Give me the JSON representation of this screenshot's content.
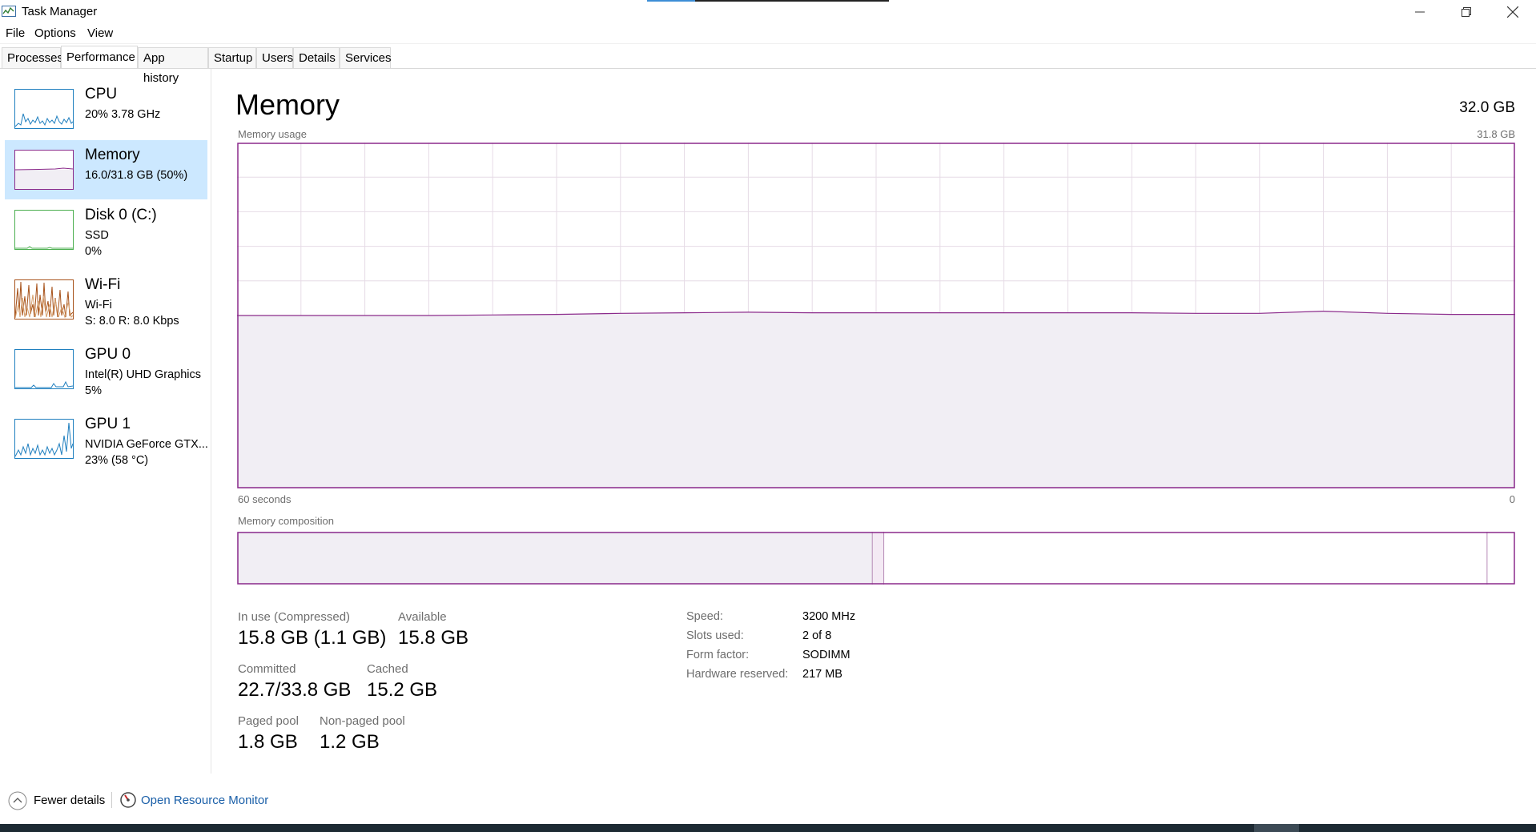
{
  "window": {
    "title": "Task Manager"
  },
  "colors": {
    "memory": "#8b2a8b",
    "cpu": "#1f7fbf",
    "disk": "#4caf50",
    "wifi": "#a7521a",
    "tab_border": "#d9d9d9",
    "selected_bg": "#cce8ff",
    "link": "#1a5fa8"
  },
  "menu": {
    "file": "File",
    "options": "Options",
    "view": "View"
  },
  "tabs": [
    {
      "label": "Processes"
    },
    {
      "label": "Performance"
    },
    {
      "label": "App history"
    },
    {
      "label": "Startup"
    },
    {
      "label": "Users"
    },
    {
      "label": "Details"
    },
    {
      "label": "Services"
    }
  ],
  "active_tab": "Performance",
  "sidebar": {
    "items": [
      {
        "name": "CPU",
        "line1": "20% 3.78 GHz",
        "line2": ""
      },
      {
        "name": "Memory",
        "line1": "16.0/31.8 GB (50%)",
        "line2": ""
      },
      {
        "name": "Disk 0 (C:)",
        "line1": "SSD",
        "line2": "0%"
      },
      {
        "name": "Wi-Fi",
        "line1": "Wi-Fi",
        "line2": "S: 8.0  R: 8.0 Kbps"
      },
      {
        "name": "GPU 0",
        "line1": "Intel(R) UHD Graphics",
        "line2": "5%"
      },
      {
        "name": "GPU 1",
        "line1": "NVIDIA GeForce GTX...",
        "line2": "23%  (58 °C)"
      }
    ],
    "selected": "Memory"
  },
  "main": {
    "title": "Memory",
    "total": "32.0 GB",
    "usage_label": "Memory usage",
    "usage_max": "31.8 GB",
    "time_left": "60 seconds",
    "time_right": "0",
    "composition_label": "Memory composition"
  },
  "chart_data": {
    "type": "area",
    "x": [
      60,
      57,
      54,
      51,
      48,
      45,
      42,
      39,
      36,
      33,
      30,
      27,
      24,
      21,
      18,
      15,
      12,
      9,
      6,
      3,
      0
    ],
    "values": [
      15.9,
      15.9,
      15.9,
      15.9,
      15.95,
      16.0,
      16.1,
      16.15,
      16.2,
      16.15,
      16.15,
      16.15,
      16.15,
      16.15,
      16.15,
      16.1,
      16.1,
      16.3,
      16.1,
      16.0,
      16.0
    ],
    "ylim": [
      0,
      31.8
    ],
    "xlim": [
      60,
      0
    ],
    "grid": true
  },
  "composition": {
    "in_use_pct": 49.7,
    "modified_pct": 0.9,
    "standby_pct": 47.2,
    "free_pct": 2.2
  },
  "stats": {
    "in_use_label": "In use (Compressed)",
    "in_use_value": "15.8 GB (1.1 GB)",
    "available_label": "Available",
    "available_value": "15.8 GB",
    "committed_label": "Committed",
    "committed_value": "22.7/33.8 GB",
    "cached_label": "Cached",
    "cached_value": "15.2 GB",
    "paged_label": "Paged pool",
    "paged_value": "1.8 GB",
    "nonpaged_label": "Non-paged pool",
    "nonpaged_value": "1.2 GB"
  },
  "details": [
    {
      "key": "Speed:",
      "value": "3200 MHz"
    },
    {
      "key": "Slots used:",
      "value": "2 of 8"
    },
    {
      "key": "Form factor:",
      "value": "SODIMM"
    },
    {
      "key": "Hardware reserved:",
      "value": "217 MB"
    }
  ],
  "footer": {
    "fewer_details": "Fewer details",
    "open_resource_monitor": "Open Resource Monitor"
  }
}
